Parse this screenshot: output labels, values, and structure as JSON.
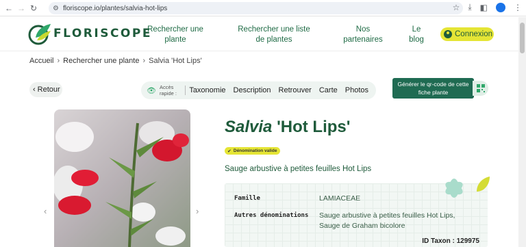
{
  "browser": {
    "url": "floriscope.io/plantes/salvia-hot-lips",
    "icons": [
      "back-icon",
      "forward-icon",
      "reload-icon",
      "tune-icon",
      "star-icon",
      "download-icon",
      "sidepanel-icon",
      "profile-icon",
      "menu-icon"
    ]
  },
  "header": {
    "logo_text": "FLORISCOPE",
    "nav": [
      {
        "label": "Rechercher une plante"
      },
      {
        "label": "Rechercher une liste de plantes"
      },
      {
        "label": "Nos partenaires"
      },
      {
        "label": "Le blog"
      }
    ],
    "connexion_label": "Connexion",
    "accent": "#e5e535",
    "brand_green": "#1f5b3b"
  },
  "breadcrumb": {
    "items": [
      "Accueil",
      "Rechercher une plante",
      "Salvia 'Hot Lips'"
    ]
  },
  "actions": {
    "retour_label": "Retour",
    "quick_label": "Accès rapide :",
    "quick_links": [
      "Taxonomie",
      "Description",
      "Retrouver",
      "Carte",
      "Photos"
    ],
    "qr_label": "Générer le qr-code de cette fiche plante"
  },
  "plant": {
    "genus": "Salvia",
    "cultivar": "'Hot Lips'",
    "badge": "Dénomination valide",
    "common_name": "Sauge arbustive à petites feuilles Hot Lips",
    "famille_label": "Famille",
    "famille_value": "LAMIACEAE",
    "autres_label": "Autres dénominations",
    "autres_value": "Sauge arbustive à petites feuilles Hot Lips, Sauge de Graham bicolore",
    "id_taxon": "ID Taxon : 129975"
  }
}
